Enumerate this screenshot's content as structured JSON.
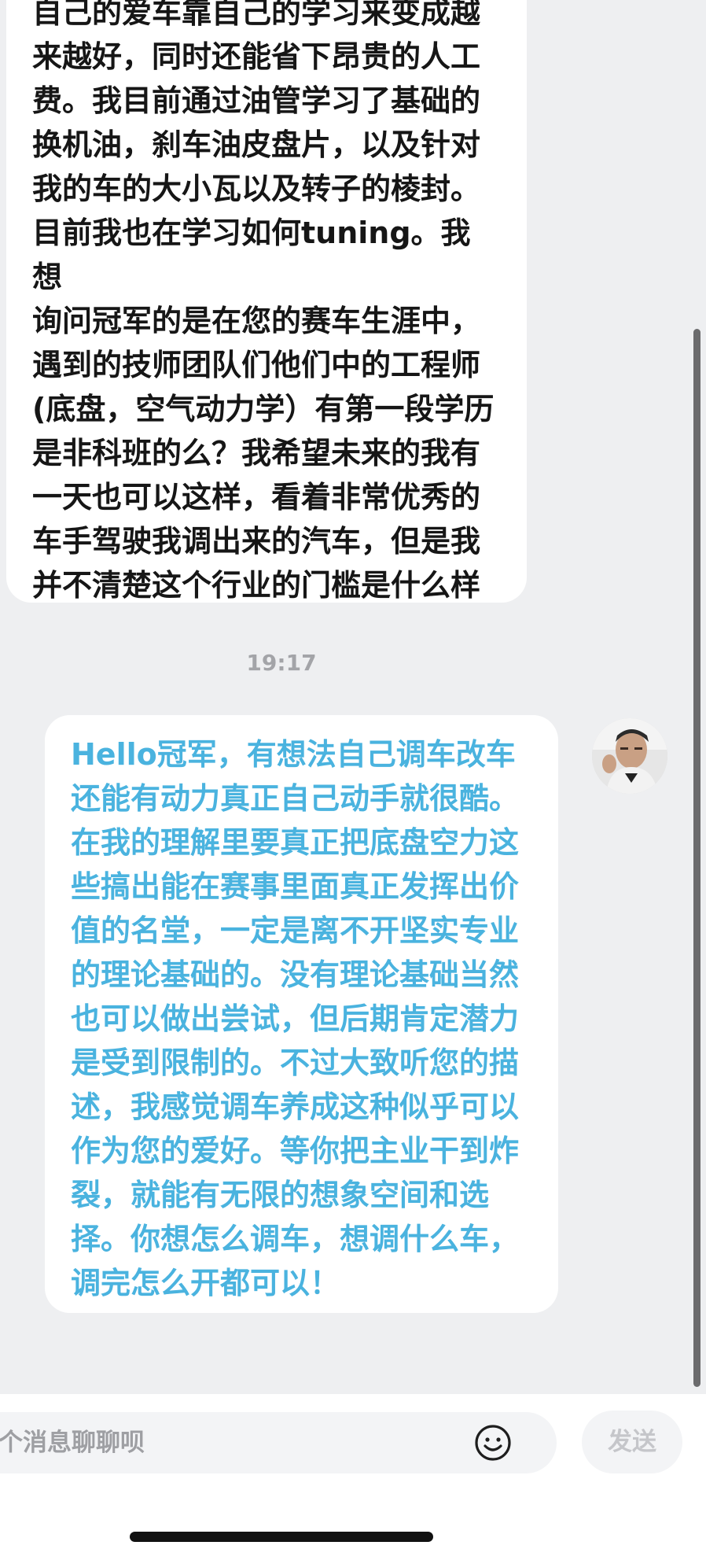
{
  "chat": {
    "incoming_message": "自己的爱车靠自己的学习来变成越\n来越好，同时还能省下昂贵的人工\n费。我目前通过油管学习了基础的\n换机油，刹车油皮盘片，以及针对\n我的车的大小瓦以及转子的棱封。\n目前我也在学习如何tuning。我想\n询问冠军的是在您的赛车生涯中，\n遇到的技师团队们他们中的工程师\n(底盘，空气动力学）有第一段学历\n是非科班的么？我希望未来的我有\n一天也可以这样，看着非常优秀的\n车手驾驶我调出来的汽车，但是我\n并不清楚这个行业的门槛是什么样\n的。非常感谢冠军！",
    "timestamp": "19:17",
    "outgoing_message": "Hello冠军，有想法自己调车改车\n还能有动力真正自己动手就很酷。\n在我的理解里要真正把底盘空力这\n些搞出能在赛事里面真正发挥出价\n值的名堂，一定是离不开坚实专业\n的理论基础的。没有理论基础当然\n也可以做出尝试，但后期肯定潜力\n是受到限制的。不过大致听您的描\n述，我感觉调车养成这种似乎可以\n作为您的爱好。等你把主业干到炸\n裂，就能有无限的想象空间和选\n择。你想怎么调车，想调什么车，\n调完怎么开都可以！",
    "incoming_bubble_color": "#ffffff",
    "outgoing_text_color": "#4ab3df"
  },
  "composer": {
    "placeholder": "个消息聊聊呗",
    "value": "",
    "emoji_icon": "smiley-icon",
    "send_label": "发送"
  }
}
